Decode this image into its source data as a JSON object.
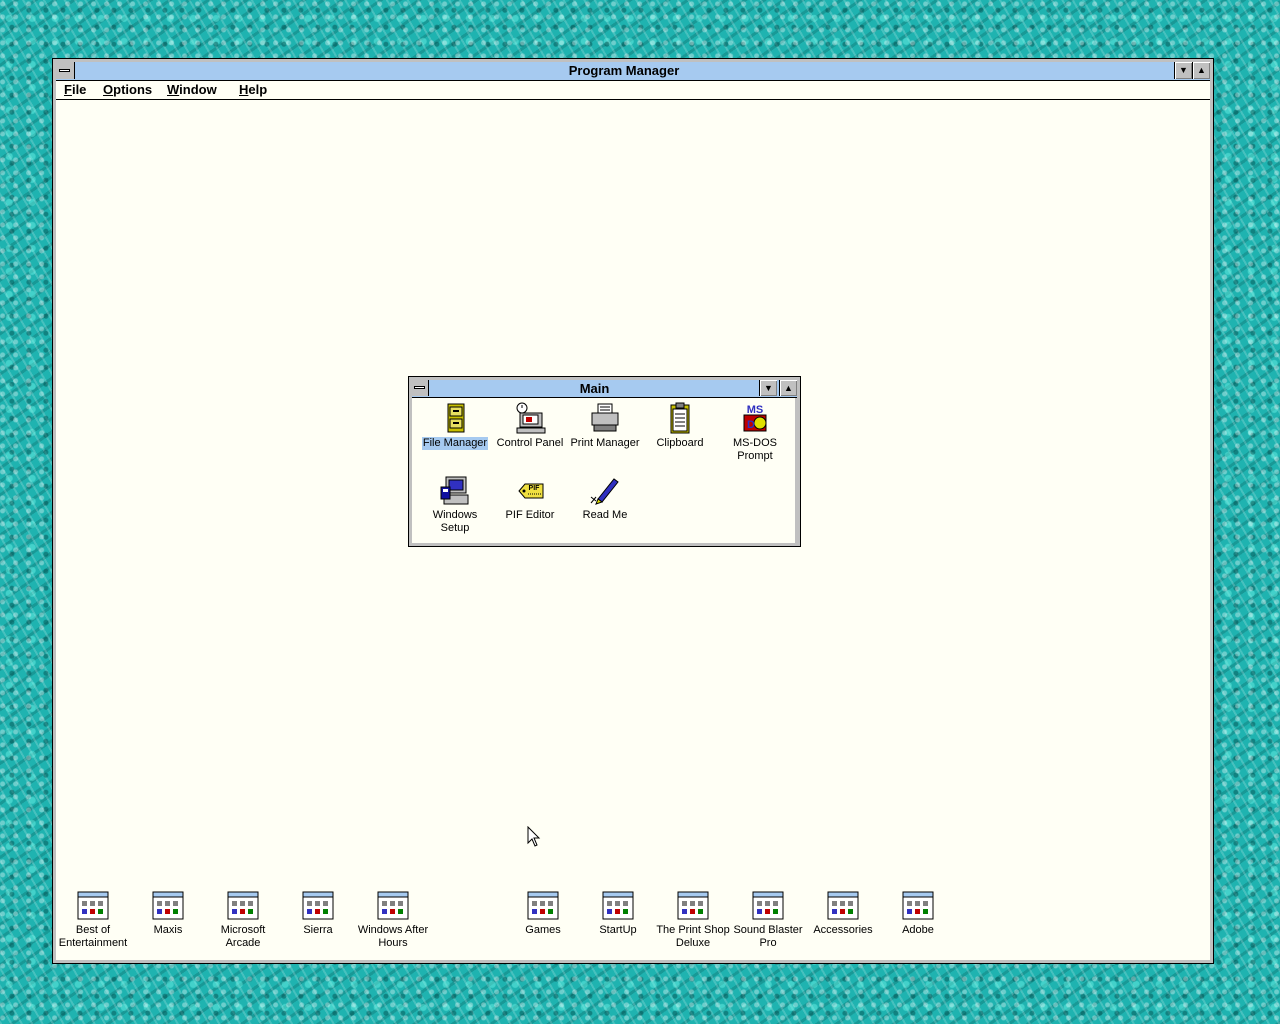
{
  "program_manager": {
    "title": "Program Manager",
    "menu": [
      "File",
      "Options",
      "Window",
      "Help"
    ]
  },
  "main_group": {
    "title": "Main",
    "items": [
      {
        "label": "File Manager",
        "icon": "file-cabinet-icon",
        "selected": true
      },
      {
        "label": "Control Panel",
        "icon": "control-panel-icon"
      },
      {
        "label": "Print Manager",
        "icon": "printer-icon"
      },
      {
        "label": "Clipboard",
        "icon": "clipboard-icon"
      },
      {
        "label": "MS-DOS Prompt",
        "icon": "ms-dos-icon"
      },
      {
        "label": "Windows Setup",
        "icon": "windows-setup-icon"
      },
      {
        "label": "PIF Editor",
        "icon": "pif-tag-icon"
      },
      {
        "label": "Read Me",
        "icon": "pen-icon"
      }
    ]
  },
  "minimized_groups": [
    "Best of Entertainment",
    "Maxis",
    "Microsoft Arcade",
    "Sierra",
    "Windows After Hours",
    "Games",
    "StartUp",
    "The Print Shop Deluxe",
    "Sound Blaster Pro",
    "Accessories",
    "Adobe"
  ],
  "colors": {
    "titlebar": "#a6caf0",
    "window_bg": "#fffff5",
    "desktop": "#1fb3b0"
  }
}
